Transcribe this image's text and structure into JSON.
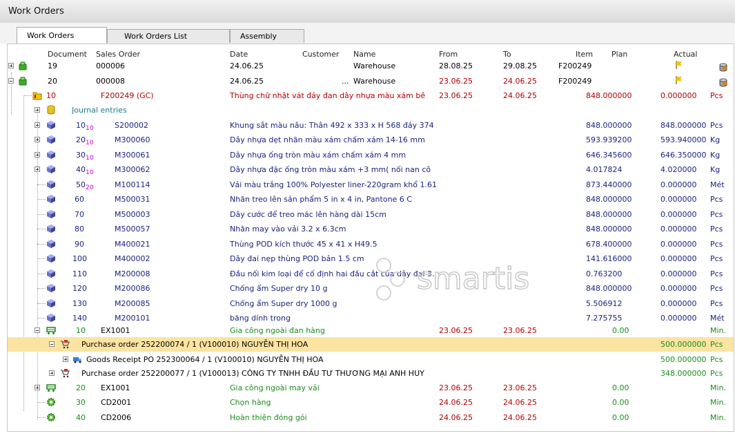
{
  "window": {
    "title": "Work Orders"
  },
  "tabs": [
    {
      "label": "Work Orders"
    },
    {
      "label": "Work Orders List"
    },
    {
      "label": "Assembly"
    }
  ],
  "headers": {
    "document": "Document",
    "sales_order": "Sales Order",
    "date": "Date",
    "customer": "Customer",
    "name": "Name",
    "from": "From",
    "to": "To",
    "item": "Item",
    "plan": "Plan",
    "actual": "Actual"
  },
  "wo19": {
    "doc": "19",
    "so": "000006",
    "date": "24.06.25",
    "name": "Warehouse",
    "from": "28.08.25",
    "to": "29.08.25",
    "item": "F200249"
  },
  "wo20": {
    "doc": "20",
    "so": "000008",
    "date": "24.06.25",
    "dots": "...",
    "name": "Warehouse",
    "from": "23.06.25",
    "to": "24.06.25",
    "item": "F200249"
  },
  "wo20_10": {
    "n": "10",
    "item": "F200249 (GC)",
    "desc": "Thùng chữ nhật vát đáy đan dây nhựa màu xám bê",
    "from": "23.06.25",
    "to": "24.06.25",
    "plan": "848.000000",
    "actual": "0.000000",
    "unit": "Pcs"
  },
  "journal": {
    "label": "Journal entries"
  },
  "comps": [
    {
      "n": "10",
      "sub": "10",
      "item": "S200002",
      "desc": "Khung sắt màu nâu: Thân 492 x 333 x H 568 đáy 374 x",
      "plan": "848.000000",
      "actual": "848.000000",
      "unit": "Pcs"
    },
    {
      "n": "20",
      "sub": "10",
      "item": "M300060",
      "desc": "Dây nhựa dẹt nhãn màu xám chấm xám 14-16 mm",
      "plan": "593.939200",
      "actual": "593.940000",
      "unit": "Kg"
    },
    {
      "n": "30",
      "sub": "10",
      "item": "M300061",
      "desc": "Dây nhựa ống tròn màu xám chấm xám 4 mm",
      "plan": "646.345600",
      "actual": "646.350000",
      "unit": "Kg"
    },
    {
      "n": "40",
      "sub": "10",
      "item": "M300062",
      "desc": "Dây nhựa  đặc ống tròn màu xám +3 mm( nối nan cô",
      "plan": "4.017824",
      "actual": "4.020000",
      "unit": "Kg"
    },
    {
      "n": "50",
      "sub": "20",
      "item": "M100114",
      "desc": "Vải màu trắng 100% Polyester liner-220gram khổ 1.61",
      "plan": "873.440000",
      "actual": "0.000000",
      "unit": "Mét"
    },
    {
      "n": "60",
      "sub": "",
      "item": "M500031",
      "desc": "Nhãn treo lên sản phẩm 5 in x 4 in, Pantone 6 C",
      "plan": "848.000000",
      "actual": "0.000000",
      "unit": "Pcs"
    },
    {
      "n": "70",
      "sub": "",
      "item": "M500003",
      "desc": "Dây cước để treo mác lên hàng dài 15cm",
      "plan": "848.000000",
      "actual": "0.000000",
      "unit": "Pcs"
    },
    {
      "n": "80",
      "sub": "",
      "item": "M500057",
      "desc": "Nhãn may vào vải 3.2 x 6.3cm",
      "plan": "848.000000",
      "actual": "0.000000",
      "unit": "Pcs"
    },
    {
      "n": "90",
      "sub": "",
      "item": "M400021",
      "desc": "Thùng POD kích thước 45 x 41 x H49.5",
      "plan": "678.400000",
      "actual": "0.000000",
      "unit": "Pcs"
    },
    {
      "n": "100",
      "sub": "",
      "item": "M400002",
      "desc": "Dây đai nẹp thùng POD bản 1.5 cm",
      "plan": "141.616000",
      "actual": "0.000000",
      "unit": "Pcs"
    },
    {
      "n": "110",
      "sub": "",
      "item": "M200008",
      "desc": "Đầu nối kim loại để cố định hai đầu cắt của dây đai 3.",
      "plan": "0.763200",
      "actual": "0.000000",
      "unit": "Pcs"
    },
    {
      "n": "120",
      "sub": "",
      "item": "M200086",
      "desc": "Chống ẩm Super dry 10 g",
      "plan": "848.000000",
      "actual": "0.000000",
      "unit": "Pcs"
    },
    {
      "n": "130",
      "sub": "",
      "item": "M200085",
      "desc": "Chống ẩm Super dry 1000 g",
      "plan": "5.506912",
      "actual": "0.000000",
      "unit": "Pcs"
    },
    {
      "n": "140",
      "sub": "",
      "item": "M200101",
      "desc": "băng dính trong",
      "plan": "7.275755",
      "actual": "0.000000",
      "unit": "Mét"
    }
  ],
  "op10": {
    "n": "10",
    "res": "EX1001",
    "desc": "Gia công ngoài đan hàng",
    "from": "23.06.25",
    "to": "23.06.25",
    "plan": "0.00",
    "unit": "Min."
  },
  "po1": {
    "label": "Purchase order 252200074 / 1 (V100010) NGUYỄN THỊ HOA",
    "actual": "500.000000",
    "unit": "Pcs"
  },
  "gr1": {
    "label": "Goods Receipt PO 252300064 / 1 (V100010) NGUYỄN THỊ HOA",
    "actual": "500.000000",
    "unit": "Pcs"
  },
  "po2": {
    "label": "Purchase order 252200077 / 1 (V100013) CÔNG TY TNHH ĐẦU TƯ THƯƠNG MẠI ANH HUY",
    "actual": "348.000000",
    "unit": "Pcs"
  },
  "ops": [
    {
      "n": "20",
      "res": "EX1001",
      "desc": "Gia công ngoài may vải",
      "from": "23.06.25",
      "to": "23.06.25",
      "plan": "0.00",
      "unit": "Min."
    },
    {
      "n": "30",
      "res": "CD2001",
      "desc": "Chọn hàng",
      "from": "24.06.25",
      "to": "24.06.25",
      "plan": "0.00",
      "unit": "Min."
    },
    {
      "n": "40",
      "res": "CD2006",
      "desc": "Hoàn thiện đóng gói",
      "from": "24.06.25",
      "to": "24.06.25",
      "plan": "0.00",
      "unit": "Min."
    }
  ],
  "watermark": {
    "text": "smartis"
  }
}
